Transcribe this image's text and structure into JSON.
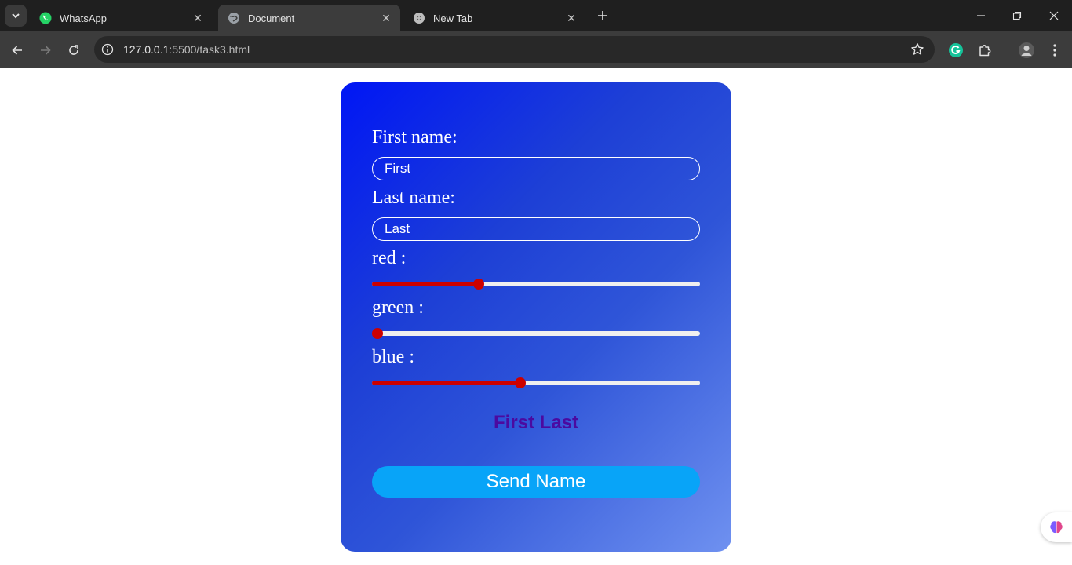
{
  "browser": {
    "tabs": [
      {
        "label": "WhatsApp",
        "icon": "whatsapp-icon",
        "active": false
      },
      {
        "label": "Document",
        "icon": "globe-icon",
        "active": true
      },
      {
        "label": "New Tab",
        "icon": "chrome-icon",
        "active": false
      }
    ],
    "url_host": "127.0.0.1",
    "url_path": ":5500/task3.html"
  },
  "form": {
    "first_name_label": "First name:",
    "first_name_value": "First",
    "last_name_label": "Last name:",
    "last_name_value": "Last",
    "red_label": "red :",
    "green_label": "green :",
    "blue_label": "blue :",
    "red_value": 0.32,
    "green_value": 0.0,
    "blue_value": 0.45,
    "output_text": "First Last",
    "send_button_label": "Send Name"
  },
  "colors": {
    "slider_accent": "#cc0000",
    "output_text": "#4b0aa0",
    "send_button": "#08a4f8"
  }
}
